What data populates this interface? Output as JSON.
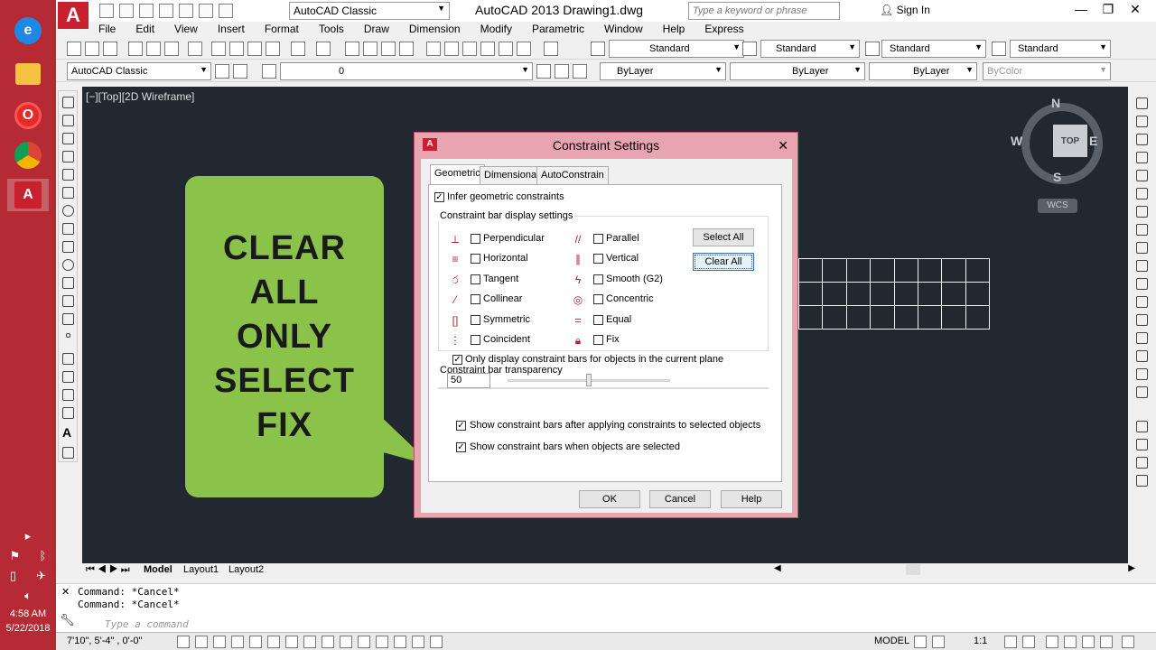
{
  "taskbar": {
    "apps": [
      {
        "name": "Internet Explorer",
        "icon": "ie-icon"
      },
      {
        "name": "File Explorer",
        "icon": "folder-icon"
      },
      {
        "name": "Opera",
        "icon": "opera-icon"
      },
      {
        "name": "Chrome",
        "icon": "chrome-icon"
      },
      {
        "name": "AutoCAD",
        "icon": "autocad-icon"
      }
    ],
    "time": "4:58 AM",
    "date": "5/22/2018"
  },
  "titlebar": {
    "workspace": "AutoCAD Classic",
    "title": "AutoCAD 2013    Drawing1.dwg",
    "search_placeholder": "Type a keyword or phrase",
    "signin": "Sign In"
  },
  "menu": [
    "File",
    "Edit",
    "View",
    "Insert",
    "Format",
    "Tools",
    "Draw",
    "Dimension",
    "Modify",
    "Parametric",
    "Window",
    "Help",
    "Express"
  ],
  "toolbar": {
    "style_text": "Standard",
    "style_dim": "Standard",
    "style_table": "Standard",
    "style_mleader": "Standard",
    "workspace2": "AutoCAD Classic",
    "layer": "0",
    "color": "ByLayer",
    "linetype": "ByLayer",
    "lineweight": "ByLayer",
    "plotstyle": "ByColor"
  },
  "viewport": {
    "label": "[−][Top][2D Wireframe]",
    "viewcube_top": "TOP",
    "compass_n": "N",
    "compass_s": "S",
    "compass_e": "E",
    "compass_w": "W",
    "wcs": "WCS"
  },
  "callout": {
    "lines": [
      "CLEAR",
      "ALL",
      "ONLY",
      "SELECT",
      "FIX"
    ],
    "color": "#8bc34a"
  },
  "layout_tabs": [
    "Model",
    "Layout1",
    "Layout2"
  ],
  "command": {
    "history": [
      "Command: *Cancel*",
      "Command: *Cancel*"
    ],
    "placeholder": "Type a command"
  },
  "status": {
    "coords": "7'10\", 5'-4\" , 0'-0\"",
    "model": "MODEL",
    "scale": "1:1"
  },
  "dialog": {
    "title": "Constraint Settings",
    "tabs": [
      "Geometric",
      "Dimensional",
      "AutoConstrain"
    ],
    "active_tab": "Geometric",
    "infer_label": "Infer geometric constraints",
    "infer_checked": true,
    "group_label": "Constraint bar display settings",
    "constraints_left": [
      {
        "label": "Perpendicular",
        "icon": "perpendicular-icon",
        "checked": false
      },
      {
        "label": "Horizontal",
        "icon": "horizontal-icon",
        "checked": false
      },
      {
        "label": "Tangent",
        "icon": "tangent-icon",
        "checked": false
      },
      {
        "label": "Collinear",
        "icon": "collinear-icon",
        "checked": false
      },
      {
        "label": "Symmetric",
        "icon": "symmetric-icon",
        "checked": false
      },
      {
        "label": "Coincident",
        "icon": "coincident-icon",
        "checked": false
      }
    ],
    "constraints_right": [
      {
        "label": "Parallel",
        "icon": "parallel-icon",
        "checked": false
      },
      {
        "label": "Vertical",
        "icon": "vertical-icon",
        "checked": false
      },
      {
        "label": "Smooth (G2)",
        "icon": "smooth-icon",
        "checked": false
      },
      {
        "label": "Concentric",
        "icon": "concentric-icon",
        "checked": false
      },
      {
        "label": "Equal",
        "icon": "equal-icon",
        "checked": false
      },
      {
        "label": "Fix",
        "icon": "fix-icon",
        "checked": false
      }
    ],
    "select_all": "Select All",
    "clear_all": "Clear All",
    "only_display_label": "Only display constraint bars for objects in the current plane",
    "only_display_checked": true,
    "transparency_label": "Constraint bar transparency",
    "transparency_value": "50",
    "transparency_fraction": 0.5,
    "show_after_label": "Show constraint bars after applying constraints to selected objects",
    "show_after_checked": true,
    "show_selected_label": "Show constraint bars when objects are selected",
    "show_selected_checked": true,
    "ok": "OK",
    "cancel": "Cancel",
    "help": "Help"
  }
}
